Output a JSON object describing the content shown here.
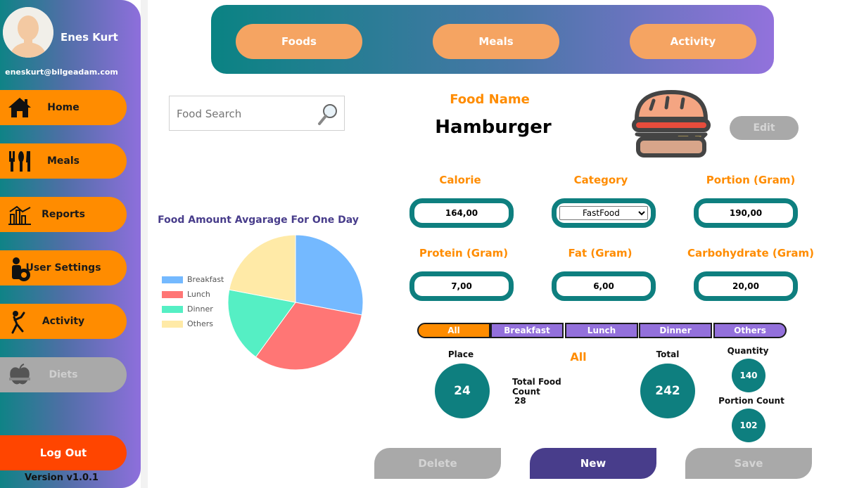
{
  "user": {
    "name": "Enes Kurt",
    "email": "eneskurt@bilgeadam.com"
  },
  "sidebar": {
    "items": [
      {
        "label": "Home",
        "icon": "home-icon"
      },
      {
        "label": "Meals",
        "icon": "cutlery-icon"
      },
      {
        "label": "Reports",
        "icon": "reports-chart-icon"
      },
      {
        "label": "User Settings",
        "icon": "user-settings-icon"
      },
      {
        "label": "Activity",
        "icon": "running-person-icon"
      },
      {
        "label": "Diets",
        "icon": "apple-scale-icon",
        "disabled": true
      }
    ],
    "logout_label": "Log Out",
    "version": "Version v1.0.1"
  },
  "topnav": {
    "tabs": [
      "Foods",
      "Meals",
      "Activity"
    ]
  },
  "search": {
    "placeholder": "Food Search",
    "icon": "magnifier-icon"
  },
  "food": {
    "name_label": "Food Name",
    "name": "Hamburger",
    "image": "hamburger-icon",
    "edit_label": "Edit",
    "fields": {
      "calorie": {
        "label": "Calorie",
        "value": "164,00"
      },
      "category": {
        "label": "Category",
        "value": "FastFood"
      },
      "portion": {
        "label": "Portion (Gram)",
        "value": "190,00"
      },
      "protein": {
        "label": "Protein (Gram)",
        "value": "7,00"
      },
      "fat": {
        "label": "Fat (Gram)",
        "value": "6,00"
      },
      "carbohydrate": {
        "label": "Carbohydrate (Gram)",
        "value": "20,00"
      }
    }
  },
  "chart_data": {
    "type": "pie",
    "title": "Food Amount Avgarage For One Day",
    "categories": [
      "Breakfast",
      "Lunch",
      "Dinner",
      "Others"
    ],
    "values": [
      28,
      32,
      18,
      22
    ],
    "colors": [
      "#74b9ff",
      "#ff7675",
      "#55efc4",
      "#ffeaa7"
    ],
    "legend": "left"
  },
  "filter": {
    "tabs": [
      "All",
      "Breakfast",
      "Lunch",
      "Dinner",
      "Others"
    ],
    "active": "All"
  },
  "stats": {
    "place_label": "Place",
    "place_value": "24",
    "selected_label": "All",
    "total_food_count_label": "Total Food Count",
    "total_food_count_value": "28",
    "total_label": "Total",
    "total_value": "242",
    "quantity_label": "Quantity",
    "quantity_value": "140",
    "portion_count_label": "Portion Count",
    "portion_count_value": "102"
  },
  "actions": {
    "delete_label": "Delete",
    "new_label": "New",
    "save_label": "Save"
  },
  "colors": {
    "accent_orange": "#ff8c00",
    "teal": "#0e7f7f",
    "purple": "#483d8b"
  }
}
